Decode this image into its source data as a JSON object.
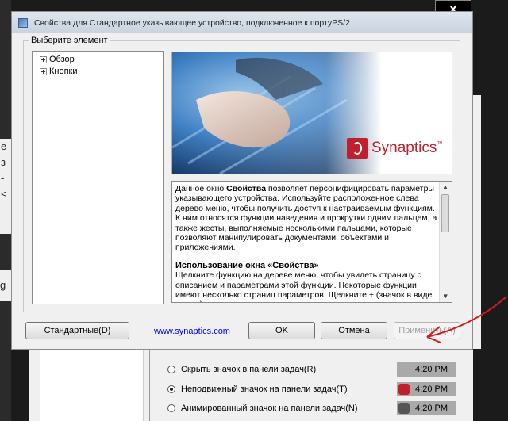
{
  "background": {
    "left_fragments": [
      "е",
      "з",
      "-",
      "<"
    ],
    "left_fragment_bottom": "g",
    "close_button_label": "x",
    "tray_rows": [
      {
        "label": "Скрыть значок в панели задач(R)",
        "time": "4:20 PM",
        "selected": false
      },
      {
        "label": "Неподвижный значок на панели задач(T)",
        "time": "4:20 PM",
        "selected": true
      },
      {
        "label": "Анимированный значок на панели задач(N)",
        "time": "4:20 PM",
        "selected": false
      }
    ]
  },
  "dialog": {
    "title": "Свойства для Стандартное указывающее устройство, подключенное к портуPS/2",
    "group_label": "Выберите элемент",
    "tree": [
      {
        "label": "Обзор"
      },
      {
        "label": "Кнопки"
      }
    ],
    "banner": {
      "brand": "Synaptics",
      "brand_mark": "™",
      "colors": {
        "brand_red": "#c0202c",
        "blue_glow": "#3c7fc4"
      }
    },
    "description": {
      "intro_before_bold": "Данное окно ",
      "intro_bold": "Свойства",
      "intro_after_bold": " позволяет персонифицировать параметры указывающего устройства. Используйте расположенное слева дерево меню, чтобы получить доступ к настраиваемым функциям. К ним относятся функции наведения и прокрутки одним пальцем, а также жесты, выполняемые несколькими пальцами, которые позволяют манипулировать документами, объектами и приложениями.",
      "heading": "Использование окна «Свойства»",
      "body": "Щелкните функцию на дереве меню, чтобы увидеть страницу с описанием и параметрами этой функции. Некоторые функции имеют несколько страниц параметров. Щелкните + (значок в виде плюса)"
    },
    "buttons": {
      "defaults": "Стандартные(D)",
      "link": "www.synaptics.com",
      "ok": "OK",
      "cancel": "Отмена",
      "apply": "Применить(A)"
    }
  },
  "annotation": {
    "color": "#d11b1b"
  }
}
